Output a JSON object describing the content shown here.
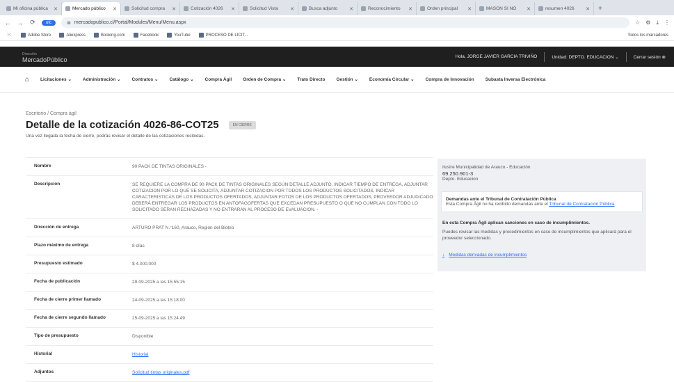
{
  "browser": {
    "tabs": [
      {
        "label": "Mi oficina pública",
        "active": false
      },
      {
        "label": "Mercado público",
        "active": true
      },
      {
        "label": "Solicitud compra",
        "active": false
      },
      {
        "label": "Cotización 4026",
        "active": false
      },
      {
        "label": "Solicitud Vista",
        "active": false
      },
      {
        "label": "Busca adjunto",
        "active": false
      },
      {
        "label": "Reconocimiento",
        "active": false
      },
      {
        "label": "Orden principal",
        "active": false
      },
      {
        "label": "MASON SI NO",
        "active": false
      },
      {
        "label": "resumen 4026",
        "active": false
      }
    ],
    "new_tab": "+",
    "url": "mercadopublico.cl/Portal/Modules/Menu/Menu.aspx",
    "pill": "ofc",
    "bookmarks": [
      "Adobe Store",
      "Aliexpress",
      "Booking.com",
      "Facebook",
      "YouTube",
      "PROCESO DE LICIT..."
    ],
    "bookmarks_right": "Todos los marcadores"
  },
  "header": {
    "logo_top": "Dirección",
    "logo": "MercadoPúblico",
    "greeting": "Hola, JORGE JAVIER GARCIA TRIVIÑO",
    "unit": "Unidad: DEPTO. EDUCACION",
    "logout": "Cerrar sesión"
  },
  "menu": {
    "items": [
      "Licitaciones",
      "Administración",
      "Contratos",
      "Catálogo",
      "Compra Ágil",
      "Orden de Compra",
      "Trato Directo",
      "Gestión",
      "Economía Circular",
      "Compra de Innovación",
      "Subasta Inversa Electrónica"
    ]
  },
  "page": {
    "breadcrumb": "Escritorio / Compra ágil",
    "title": "Detalle de la cotización 4026-86-COT25",
    "badge": "EN CIERRE",
    "subtitle": "Una vez llegada la fecha de cierre, podrás revisar el detalle de las cotizaciones recibidas."
  },
  "details": [
    {
      "label": "Nombre",
      "value": "90 PACK DE TINTAS ORIGINALES -"
    },
    {
      "label": "Descripción",
      "value": "SE REQUIERE LA COMPRA DE 90 PACK DE TINTAS ORIGINALES SEGÚN DETALLE ADJUNTO, INDICAR TIEMPO DE ENTREGA, ADJUNTAR COTIZACION POR LO QUE SE SOLICITA, ADJUNTAR COTIZACION POR TODOS LOS PRODUCTOS SOLICITADOS, INDICAR CARACTERISTICAS DE LOS PRODUCTOS OFERTADOS, ADJUNTAR FOTOS DE LOS PRODUCTOS OFERTADOS, PROVEEDOR ADJUDICADO DEBERÁ ENTREGAR LOS PRODUCTOS EN ANTOFAGOFERTAS QUE EXCEDAN PRESUPUESTO O QUE NO CUMPLAN CON TODO LO SOLICITADO SERAN RECHAZADAS Y NO ENTRARAN AL PROCESO DE EVALUACION. -"
    },
    {
      "label": "Dirección de entrega",
      "value": "ARTURO PRAT N.°160, Arauco, Región del Biobío"
    },
    {
      "label": "Plazo máximo de entrega",
      "value": "8 días"
    },
    {
      "label": "Presupuesto estimado",
      "value": "$ 4.000.000"
    },
    {
      "label": "Fecha de publicación",
      "value": "29-09-2025 a las 15:55:15"
    },
    {
      "label": "Fecha de cierre primer llamado",
      "value": "24-09-2025 a las 15:18:00"
    },
    {
      "label": "Fecha de cierre segundo llamado",
      "value": "25-09-2025 a las 15:24:49"
    },
    {
      "label": "Tipo de presupuesto",
      "value": "Disponible"
    },
    {
      "label": "Historial",
      "value": "Historial"
    },
    {
      "label": "Adjuntos",
      "value": "Solicitud tintas originales.pdf"
    }
  ],
  "sidebar": {
    "org": "Ilustre Municipalidad de Arauco - Educación",
    "rut": "69.250.901-3",
    "dept": "Depto. Educacion",
    "tribunal_title": "Demandas ante el Tribunal de Contratación Pública",
    "tribunal_text": "Esta Compra Ágil no ha recibido demandas ante el",
    "tribunal_link": "Tribunal de Contratación Pública",
    "sanctions_title": "En esta Compra Ágil aplican sanciones en caso de incumplimientos.",
    "sanctions_text": "Puedes revisar las medidas y procedimientos en caso de incumplimientos que aplicará para el proveedor seleccionado.",
    "measures_link": "Medidas derivadas de incumplimientos"
  }
}
